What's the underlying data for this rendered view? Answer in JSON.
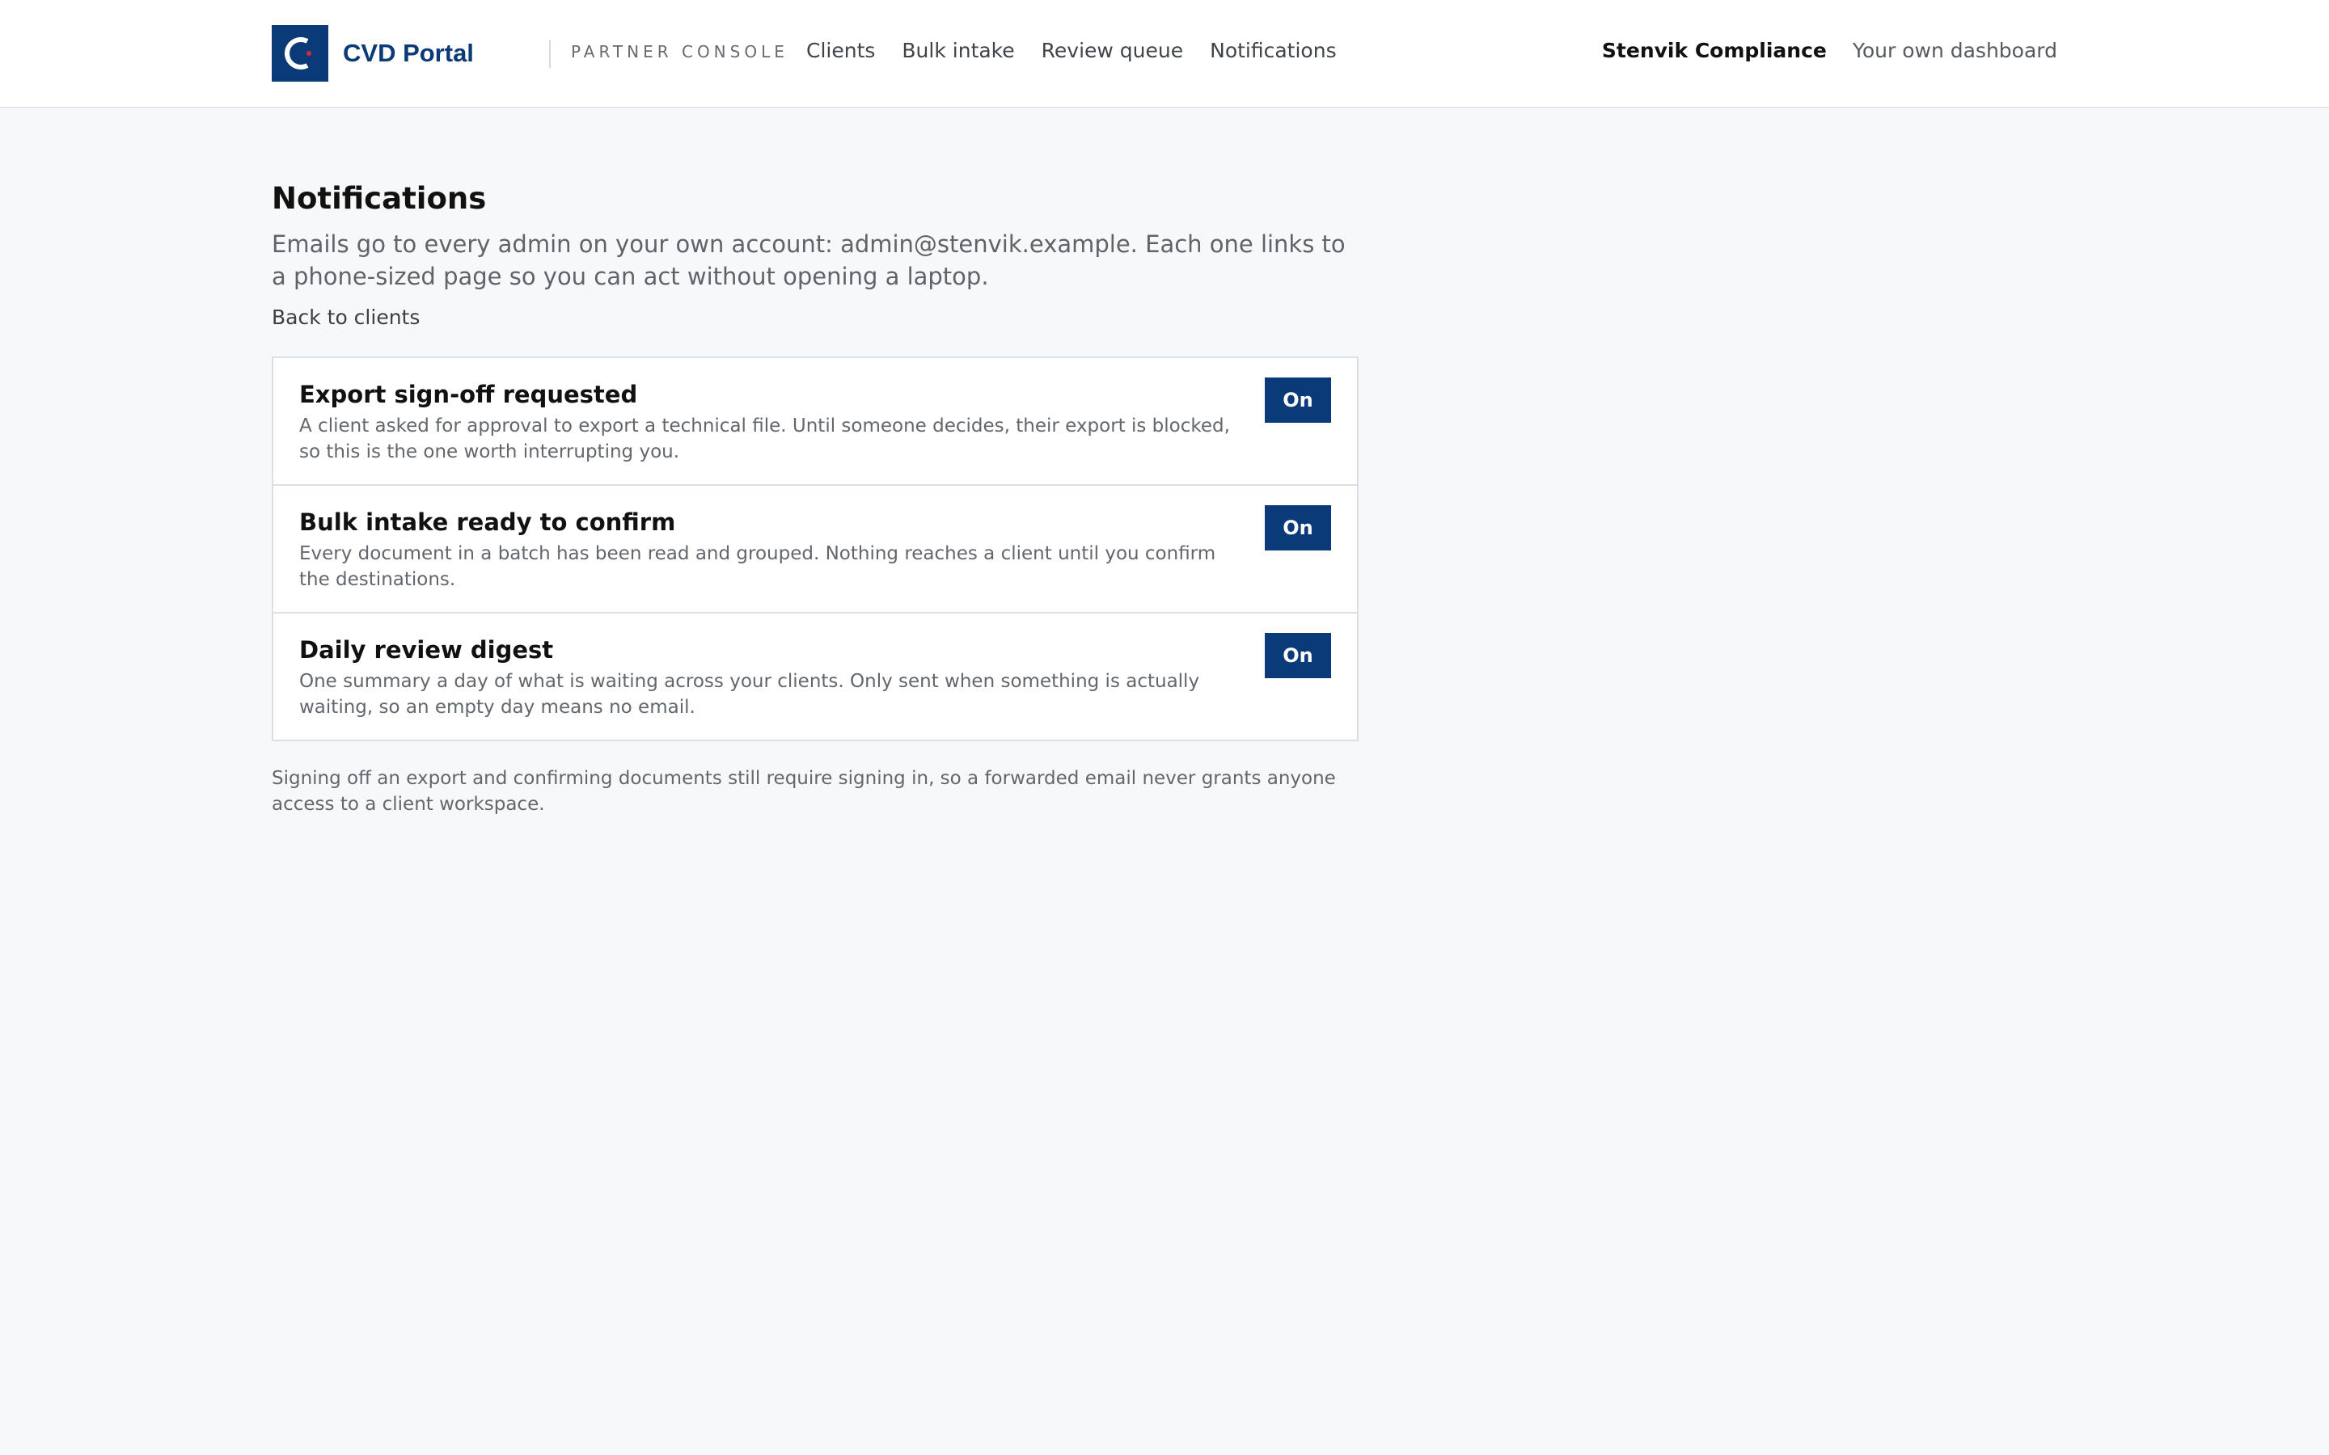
{
  "header": {
    "logo_text": "CVD Portal",
    "console_label": "PARTNER CONSOLE",
    "nav": [
      {
        "label": "Clients"
      },
      {
        "label": "Bulk intake"
      },
      {
        "label": "Review queue"
      },
      {
        "label": "Notifications"
      }
    ],
    "org_name": "Stenvik Compliance",
    "own_dashboard_label": "Your own dashboard"
  },
  "page": {
    "title": "Notifications",
    "intro": "Emails go to every admin on your own account: admin@stenvik.example. Each one links to a phone-sized page so you can act without opening a laptop.",
    "back_link": "Back to clients"
  },
  "notifications": [
    {
      "title": "Export sign-off requested",
      "description": "A client asked for approval to export a technical file. Until someone decides, their export is blocked, so this is the one worth interrupting you.",
      "toggle_label": "On"
    },
    {
      "title": "Bulk intake ready to confirm",
      "description": "Every document in a batch has been read and grouped. Nothing reaches a client until you confirm the destinations.",
      "toggle_label": "On"
    },
    {
      "title": "Daily review digest",
      "description": "One summary a day of what is waiting across your clients. Only sent when something is actually waiting, so an empty day means no email.",
      "toggle_label": "On"
    }
  ],
  "footnote": "Signing off an export and confirming documents still require signing in, so a forwarded email never grants anyone access to a client workspace.",
  "colors": {
    "brand": "#0b3a78",
    "background": "#f7f8fa",
    "card_bg": "#ffffff",
    "muted_text": "#62676e"
  }
}
